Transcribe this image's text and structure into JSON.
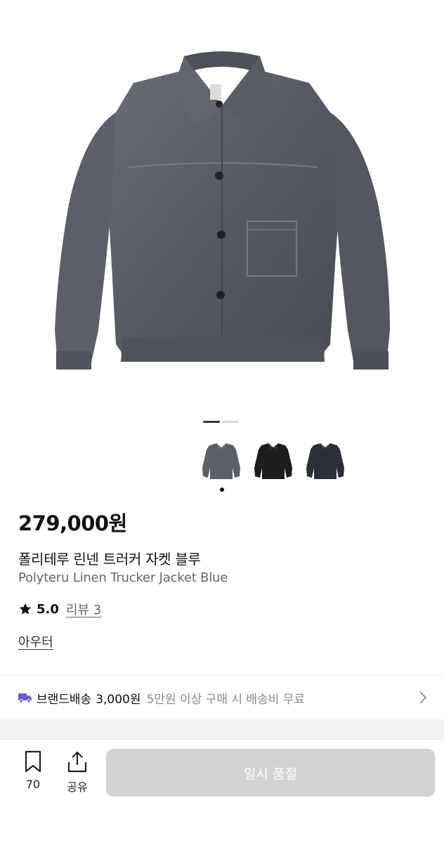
{
  "product": {
    "price": "279,000원",
    "name_ko": "폴리테루 린넨 트러커 자켓 블루",
    "name_en": "Polyteru Linen Trucker Jacket Blue",
    "rating": "5.0",
    "review_label": "리뷰 3",
    "category": "아우터",
    "main_color": "#5b5d66"
  },
  "gallery": {
    "image_count": 2,
    "current_index": 1,
    "thumbnails": [
      {
        "color": "#5d5f68",
        "selected": true
      },
      {
        "color": "#1d1d1f",
        "selected": false
      },
      {
        "color": "#2d2f38",
        "selected": false
      }
    ]
  },
  "shipping": {
    "label": "브랜드배송",
    "fee": "3,000원",
    "condition": "5만원 이상 구매 시 배송비 무료",
    "icon_color": "#6b5bd8"
  },
  "bottom": {
    "bookmark_count": "70",
    "share_label": "공유",
    "soldout_label": "일시 품절"
  }
}
